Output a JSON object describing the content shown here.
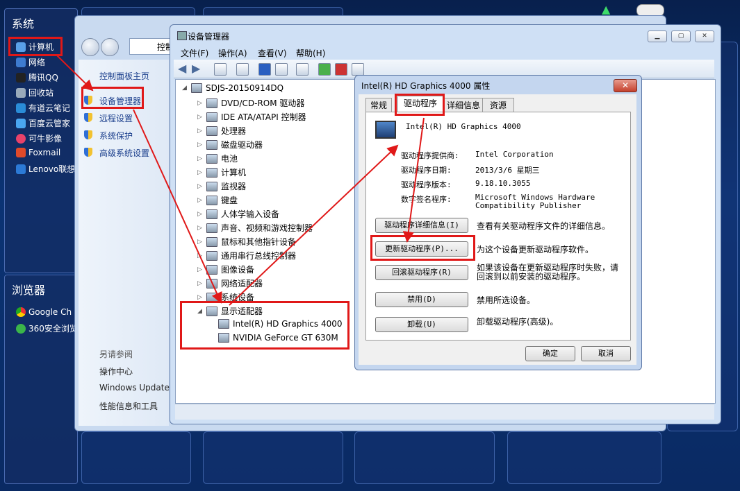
{
  "start_menu": {
    "section_system": "系统",
    "items": [
      {
        "label": "计算机",
        "icon": "computer-icon"
      },
      {
        "label": "网络",
        "icon": "network-icon"
      },
      {
        "label": "腾讯QQ",
        "icon": "qq-icon"
      },
      {
        "label": "回收站",
        "icon": "recycle-bin-icon"
      },
      {
        "label": "有道云笔记",
        "icon": "note-icon"
      },
      {
        "label": "百度云管家",
        "icon": "baidu-cloud-icon"
      },
      {
        "label": "可牛影像",
        "icon": "image-editor-icon"
      },
      {
        "label": "Foxmail",
        "icon": "foxmail-icon"
      },
      {
        "label": "Lenovo联想",
        "icon": "lenovo-icon"
      }
    ],
    "section_browser": "浏览器",
    "browsers": [
      {
        "label": "Google Ch",
        "icon": "chrome-icon"
      },
      {
        "label": "360安全浏览",
        "icon": "browser-360-icon"
      }
    ]
  },
  "control_panel": {
    "address_text": "控制",
    "home_link": "控制面板主页",
    "links": [
      "设备管理器",
      "远程设置",
      "系统保护",
      "高级系统设置"
    ],
    "see_also_title": "另请参阅",
    "see_also": [
      "操作中心",
      "Windows Update",
      "性能信息和工具"
    ]
  },
  "device_manager": {
    "title": "设备管理器",
    "menu": [
      "文件(F)",
      "操作(A)",
      "查看(V)",
      "帮助(H)"
    ],
    "root": "SDJS-20150914DQ",
    "categories": [
      "DVD/CD-ROM 驱动器",
      "IDE ATA/ATAPI 控制器",
      "处理器",
      "磁盘驱动器",
      "电池",
      "计算机",
      "监视器",
      "键盘",
      "人体学输入设备",
      "声音、视频和游戏控制器",
      "鼠标和其他指针设备",
      "通用串行总线控制器",
      "图像设备",
      "网络适配器",
      "系统设备",
      "显示适配器"
    ],
    "display_adapters": [
      "Intel(R) HD Graphics 4000",
      "NVIDIA GeForce GT 630M"
    ]
  },
  "properties": {
    "title": "Intel(R) HD Graphics 4000 属性",
    "tabs": [
      "常规",
      "驱动程序",
      "详细信息",
      "资源"
    ],
    "device_name": "Intel(R) HD Graphics 4000",
    "fields": [
      {
        "label": "驱动程序提供商:",
        "value": "Intel Corporation"
      },
      {
        "label": "驱动程序日期:",
        "value": "2013/3/6 星期三"
      },
      {
        "label": "驱动程序版本:",
        "value": "9.18.10.3055"
      },
      {
        "label": "数字签名程序:",
        "value": "Microsoft Windows Hardware Compatibility Publisher"
      }
    ],
    "actions": [
      {
        "button": "驱动程序详细信息(I)",
        "desc": "查看有关驱动程序文件的详细信息。"
      },
      {
        "button": "更新驱动程序(P)...",
        "desc": "为这个设备更新驱动程序软件。"
      },
      {
        "button": "回滚驱动程序(R)",
        "desc": "如果该设备在更新驱动程序时失败，请 回滚到以前安装的驱动程序。"
      },
      {
        "button": "禁用(D)",
        "desc": "禁用所选设备。"
      },
      {
        "button": "卸载(U)",
        "desc": "卸载驱动程序(高级)。"
      }
    ],
    "ok": "确定",
    "cancel": "取消"
  },
  "colors": {
    "highlight": "#e01818",
    "link": "#1a3e8c"
  }
}
